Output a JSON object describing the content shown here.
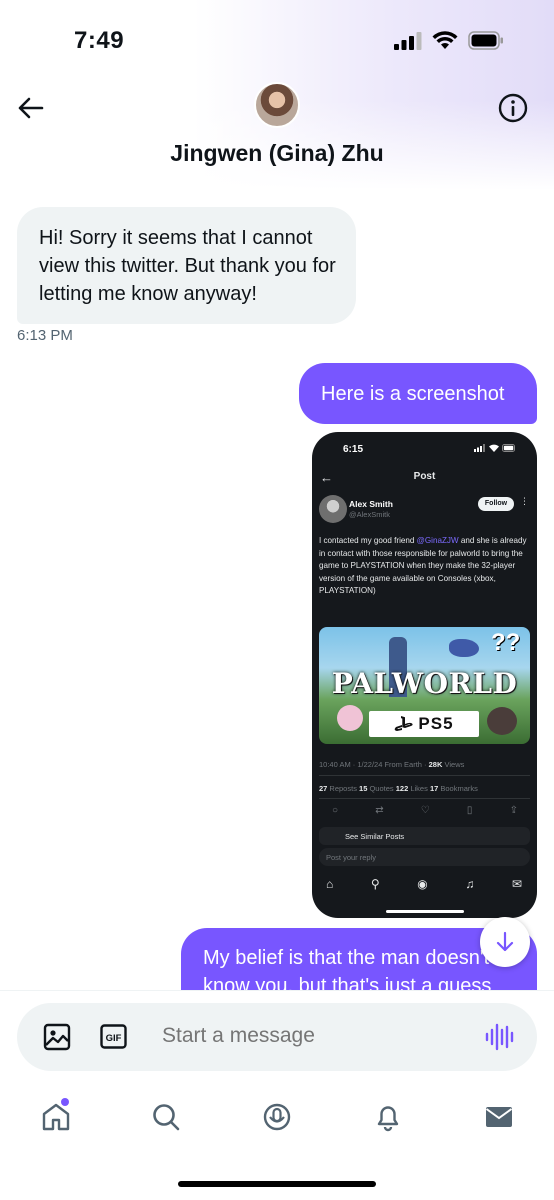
{
  "status_bar": {
    "time": "7:49"
  },
  "header": {
    "contact_name": "Jingwen (Gina) Zhu"
  },
  "messages": {
    "incoming_1": "Hi! Sorry it seems that I cannot view this twitter. But thank you for letting me know anyway!",
    "incoming_1_time": "6:13 PM",
    "outgoing_1": "Here is a screenshot",
    "outgoing_2": "My belief is that the man doesn't know you, but that's just a guess"
  },
  "embedded_screenshot": {
    "time": "6:15",
    "title": "Post",
    "author": "Alex Smith",
    "handle": "@AlexSmitk",
    "follow_label": "Follow",
    "body_before": "I contacted my good friend ",
    "mention": "@GinaZJW",
    "body_after": " and she is already in contact with those responsible for palworld to bring the game to PLAYSTATION when they make the 32-player version of the game available on Consoles (xbox, PLAYSTATION)",
    "image_logo": "PALWORLD",
    "image_question": "??",
    "image_ps5": "PS5",
    "meta_time": "10:40 AM · 1/22/24 From Earth · ",
    "meta_views": "28K",
    "meta_views_label": " Views",
    "stats": {
      "reposts": "27",
      "reposts_label": " Reposts  ",
      "quotes": "15",
      "quotes_label": " Quotes  ",
      "likes": "122",
      "likes_label": " Likes  ",
      "bookmarks": "17",
      "bookmarks_label": " Bookmarks"
    },
    "see_similar": "See Similar Posts",
    "reply_placeholder": "Post your reply"
  },
  "composer": {
    "placeholder": "Start a message",
    "gif_label": "GIF"
  },
  "colors": {
    "accent": "#7856ff",
    "incoming_bubble": "#eff3f4",
    "dark_bg": "#15181c"
  }
}
